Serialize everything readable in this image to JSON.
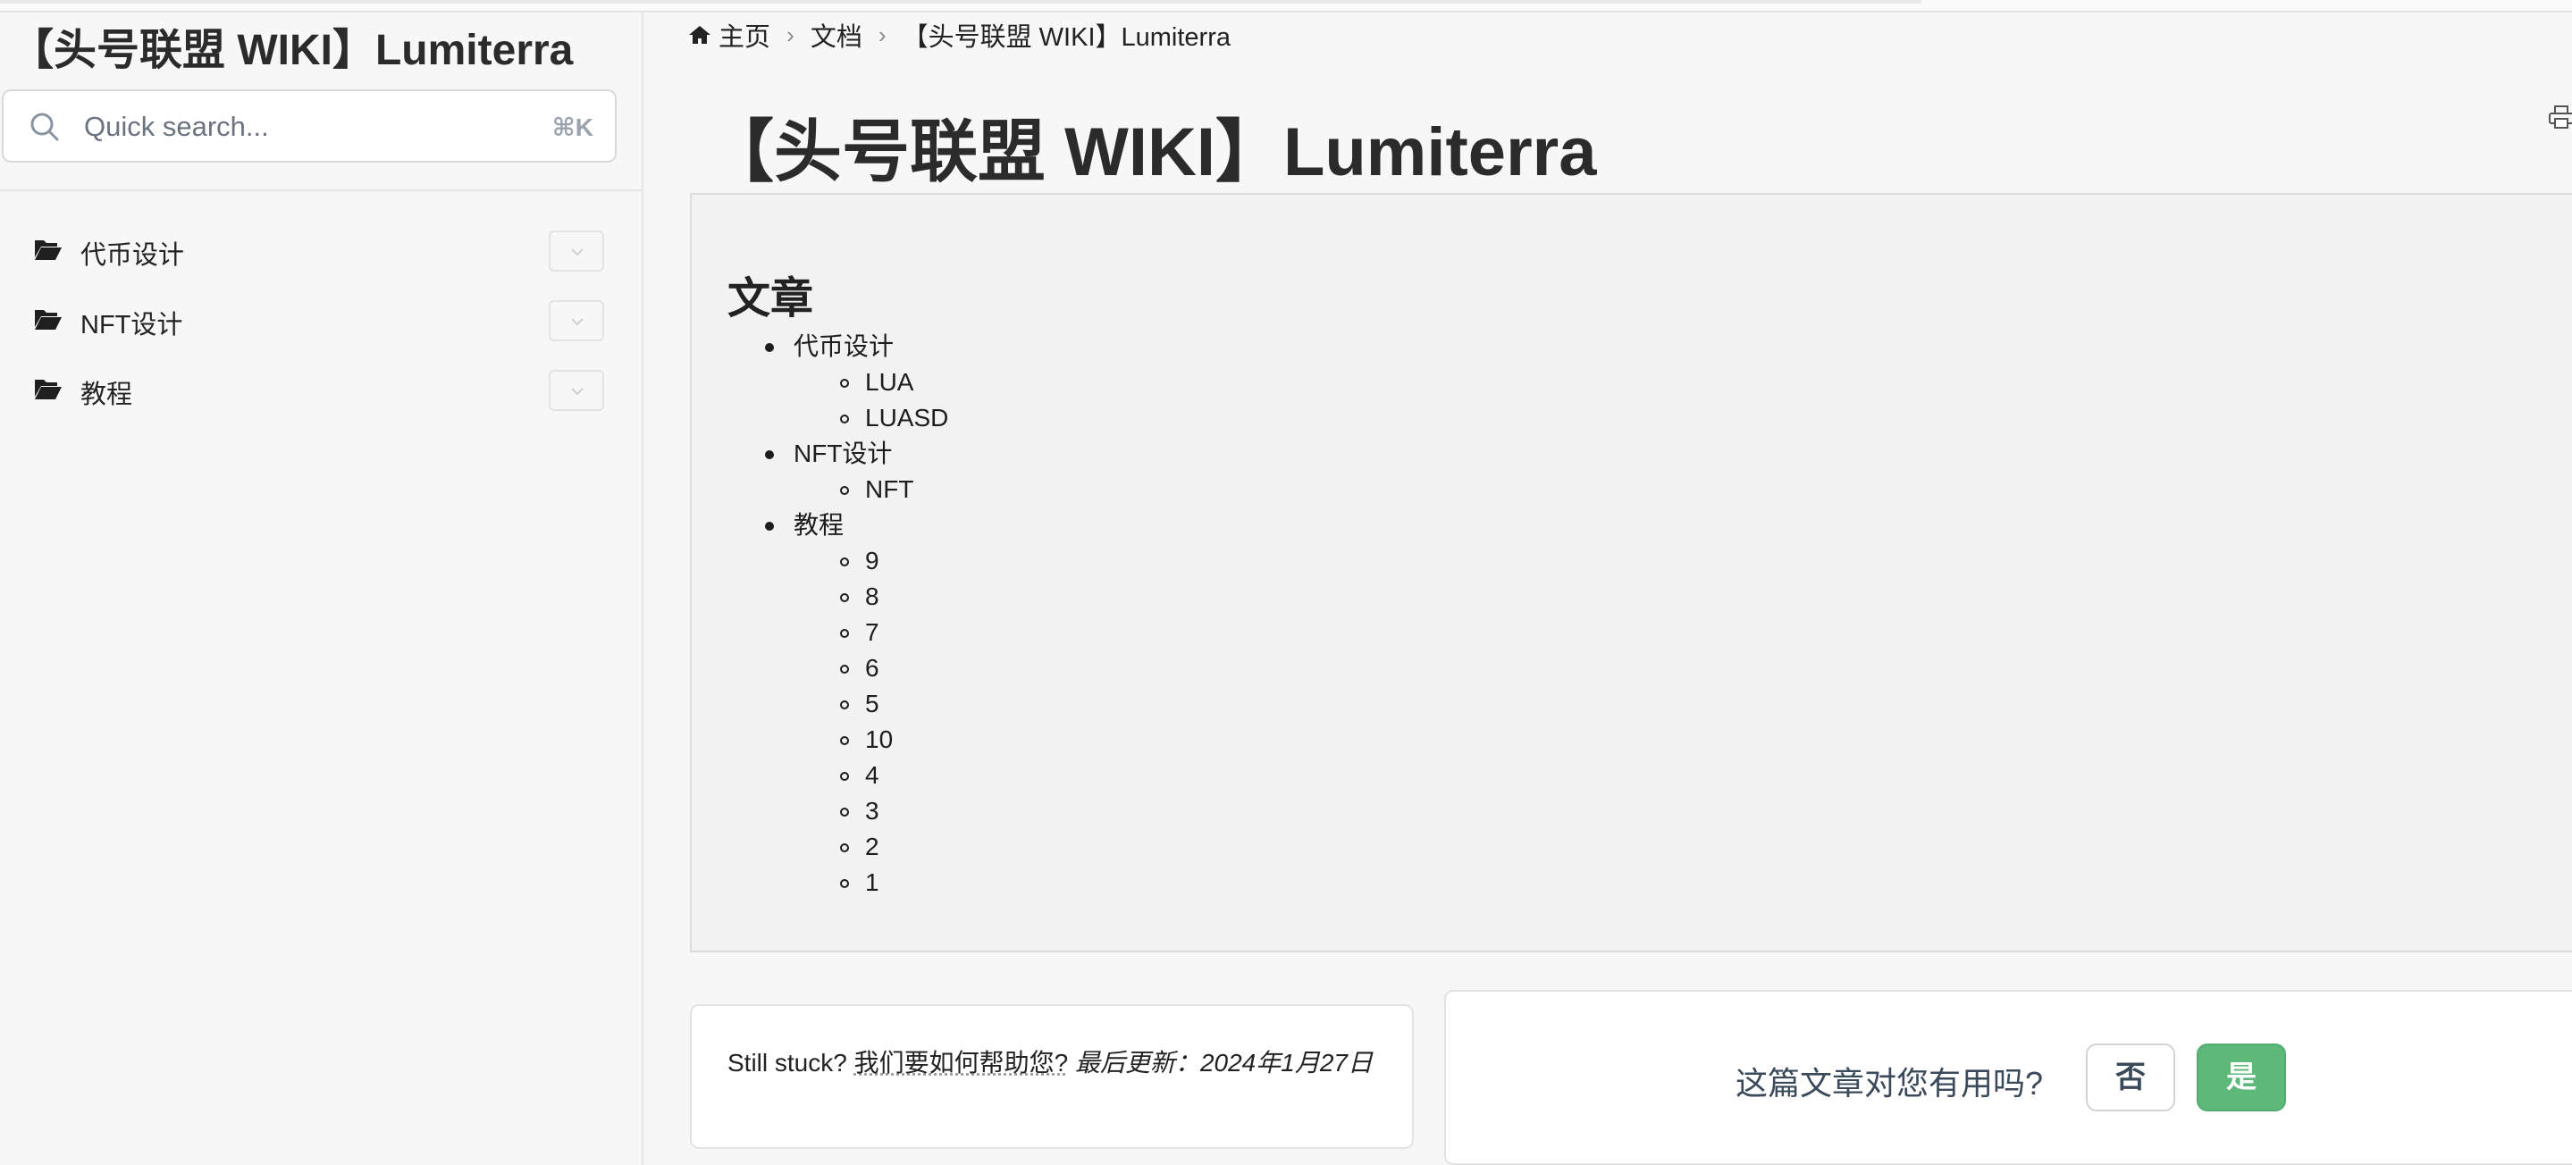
{
  "site": {
    "title": "【头号联盟 WIKI】Lumiterra"
  },
  "search": {
    "placeholder": "Quick search...",
    "shortcut": "⌘K"
  },
  "sidebar": {
    "items": [
      {
        "label": "代币设计",
        "icon": "folder-open-icon"
      },
      {
        "label": "NFT设计",
        "icon": "folder-open-icon"
      },
      {
        "label": "教程",
        "icon": "folder-open-icon"
      }
    ]
  },
  "breadcrumb": {
    "home": "主页",
    "docs": "文档",
    "current": "【头号联盟 WIKI】Lumiterra",
    "separator": "›"
  },
  "page": {
    "title": "【头号联盟 WIKI】Lumiterra"
  },
  "content": {
    "heading": "文章",
    "sections": [
      {
        "label": "代币设计",
        "children": [
          "LUA",
          "LUASD"
        ]
      },
      {
        "label": "NFT设计",
        "children": [
          "NFT"
        ]
      },
      {
        "label": "教程",
        "children": [
          "9",
          "8",
          "7",
          "6",
          "5",
          "10",
          "4",
          "3",
          "2",
          "1"
        ]
      }
    ]
  },
  "footer": {
    "stuck_prefix": "Still stuck?",
    "help_link": "我们要如何帮助您?",
    "last_updated": "最后更新：2024年1月27日"
  },
  "feedback": {
    "question": "这篇文章对您有用吗?",
    "no_label": "否",
    "yes_label": "是"
  },
  "colors": {
    "yes_button": "#5cb97a",
    "background": "#f7f7f7"
  }
}
